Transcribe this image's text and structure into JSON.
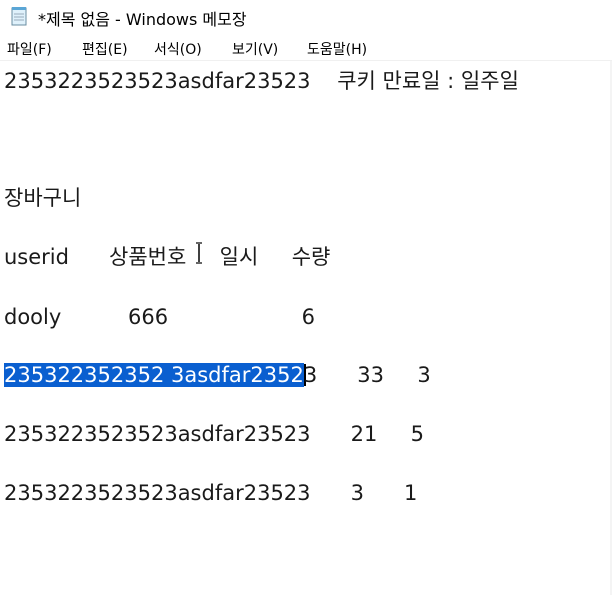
{
  "window": {
    "title": "*제목 없음 - Windows 메모장",
    "icon": "notepad-icon"
  },
  "menu": [
    {
      "label": "파일(F)"
    },
    {
      "label": "편집(E)"
    },
    {
      "label": "서식(O)"
    },
    {
      "label": "보기(V)"
    },
    {
      "label": "도움말(H)"
    }
  ],
  "editor": {
    "lines": [
      {
        "text": "2353223523523asdfar23523    쿠키 만료일 : 일주일"
      },
      {
        "text": "장바구니"
      },
      {
        "text": "userid      상품번호     일시     수량"
      },
      {
        "text": "dooly          666                    6"
      },
      {
        "text_selected": "235322352352 3asdfar2352",
        "text_rest": "3      33     3"
      },
      {
        "text": "2353223523523asdfar23523      21     5"
      },
      {
        "text": "2353223523523asdfar23523      3      1"
      }
    ]
  },
  "colors": {
    "selection": "#0a5fd0",
    "text": "#1a1a1a"
  }
}
